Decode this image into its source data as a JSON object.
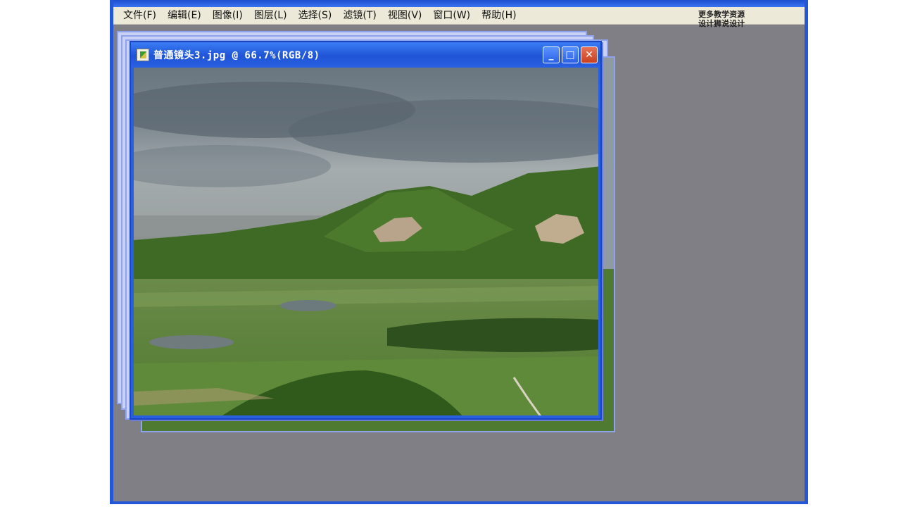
{
  "menubar": {
    "items": [
      {
        "label": "文件(F)"
      },
      {
        "label": "编辑(E)"
      },
      {
        "label": "图像(I)"
      },
      {
        "label": "图层(L)"
      },
      {
        "label": "选择(S)"
      },
      {
        "label": "滤镜(T)"
      },
      {
        "label": "视图(V)"
      },
      {
        "label": "窗口(W)"
      },
      {
        "label": "帮助(H)"
      }
    ]
  },
  "document": {
    "title": "普通镜头3.jpg @ 66.7%(RGB/8)",
    "zoom": "66.7%",
    "mode": "RGB/8",
    "buttons": {
      "minimize": "_",
      "maximize": "□",
      "close": "✕"
    }
  },
  "watermark": {
    "line1": "更多教学资源",
    "line2": "设计狮说设计"
  },
  "colors": {
    "app_frame": "#2457d8",
    "workspace": "#807f85",
    "menubar": "#ece9d8",
    "titlebar": "#2a60e2"
  }
}
